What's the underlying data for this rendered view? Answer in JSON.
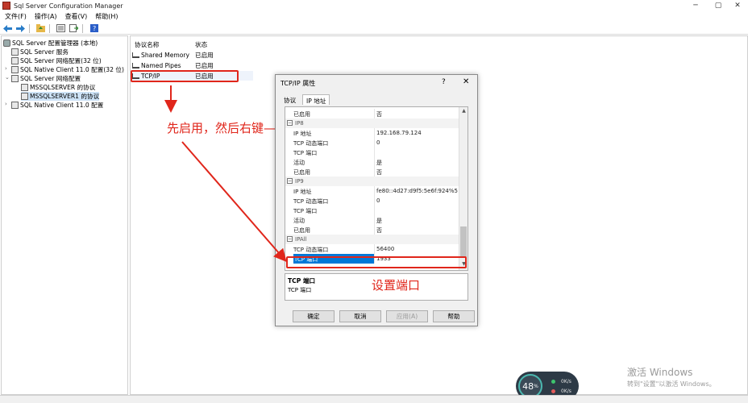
{
  "window": {
    "title": "Sql Server Configuration Manager",
    "minimize": "─",
    "restore": "▢",
    "close": "✕"
  },
  "menu": [
    "文件(F)",
    "操作(A)",
    "查看(V)",
    "帮助(H)"
  ],
  "toolbar": {
    "icons": [
      "back-arrow-icon",
      "forward-arrow-icon",
      "up-folder-icon",
      "properties-icon",
      "export-list-icon",
      "help-icon"
    ]
  },
  "tree": {
    "root": "SQL Server 配置管理器 (本地)",
    "items": [
      "SQL Server 服务",
      "SQL Server 网络配置(32 位)",
      "SQL Native Client 11.0 配置(32 位)",
      "SQL Server 网络配置",
      "MSSQLSERVER 的协议",
      "MSSQLSERVER1 的协议",
      "SQL Native Client 11.0 配置"
    ]
  },
  "protocols": {
    "header_name": "协议名称",
    "header_status": "状态",
    "rows": [
      {
        "name": "Shared Memory",
        "status": "已启用"
      },
      {
        "name": "Named Pipes",
        "status": "已启用"
      },
      {
        "name": "TCP/IP",
        "status": "已启用"
      }
    ]
  },
  "annotations": {
    "enable_hint": "先启用，然后右键—选择属性",
    "port_hint": "设置端口"
  },
  "dialog": {
    "title": "TCP/IP 属性",
    "help": "?",
    "close": "✕",
    "tabs": [
      "协议",
      "IP 地址"
    ],
    "grid_rows": [
      {
        "k": "已启用",
        "v": "否"
      },
      {
        "k": "IP8",
        "v": "",
        "header": true
      },
      {
        "k": "IP 地址",
        "v": "192.168.79.124"
      },
      {
        "k": "TCP 动态端口",
        "v": "0"
      },
      {
        "k": "TCP 端口",
        "v": ""
      },
      {
        "k": "活动",
        "v": "是"
      },
      {
        "k": "已启用",
        "v": "否"
      },
      {
        "k": "IP9",
        "v": "",
        "header": true
      },
      {
        "k": "IP 地址",
        "v": "fe80::4d27:d9f5:5e6f:924%5"
      },
      {
        "k": "TCP 动态端口",
        "v": "0"
      },
      {
        "k": "TCP 端口",
        "v": ""
      },
      {
        "k": "活动",
        "v": "是"
      },
      {
        "k": "已启用",
        "v": "否"
      },
      {
        "k": "IPAll",
        "v": "",
        "header": true
      },
      {
        "k": "TCP 动态端口",
        "v": "56400"
      },
      {
        "k": "TCP 端口",
        "v": "1933",
        "selected": true
      }
    ],
    "desc_title": "TCP 端口",
    "desc_text": "TCP 端口",
    "buttons": {
      "ok": "确定",
      "cancel": "取消",
      "apply": "应用(A)",
      "help": "帮助"
    }
  },
  "watermark": {
    "line1": "激活 Windows",
    "line2": "转到\"设置\"以激活 Windows。"
  },
  "net_widget": {
    "percent": "48",
    "percent_unit": "%",
    "up": "0K/s",
    "down": "0K/s"
  }
}
